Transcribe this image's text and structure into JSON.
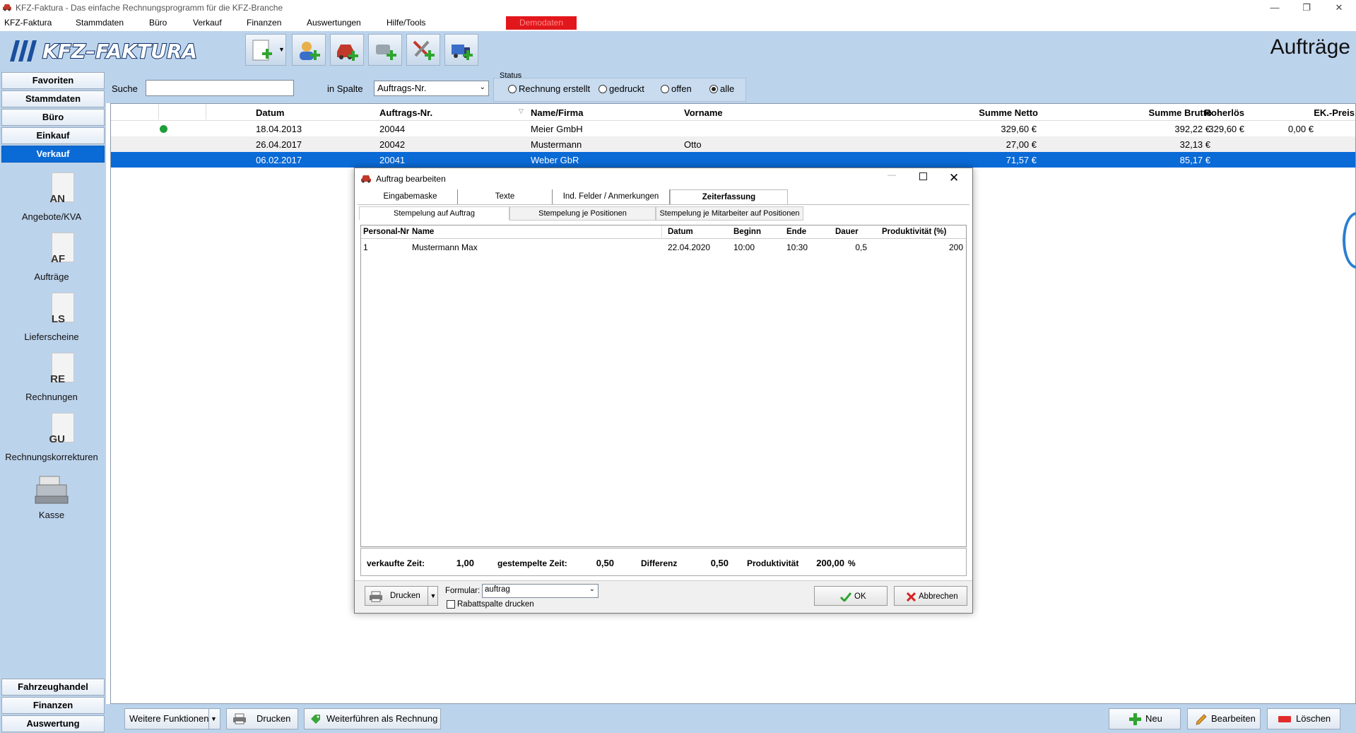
{
  "window": {
    "title": "KFZ-Faktura - Das einfache Rechnungsprogramm für die KFZ-Branche"
  },
  "menu": {
    "items": [
      "KFZ-Faktura",
      "Stammdaten",
      "Büro",
      "Verkauf",
      "Finanzen",
      "Auswertungen",
      "Hilfe/Tools"
    ],
    "demo_badge": "Demodaten"
  },
  "header": {
    "logo_text": "KFZ-FAKTURA",
    "page_title": "Aufträge"
  },
  "sidebar": {
    "sections": [
      "Favoriten",
      "Stammdaten",
      "Büro",
      "Einkauf",
      "Verkauf"
    ],
    "active": "Verkauf",
    "modules": [
      {
        "abbr": "AN",
        "label": "Angebote/KVA"
      },
      {
        "abbr": "AF",
        "label": "Aufträge"
      },
      {
        "abbr": "LS",
        "label": "Lieferscheine"
      },
      {
        "abbr": "RE",
        "label": "Rechnungen"
      },
      {
        "abbr": "GU",
        "label": "Rechnungskorrekturen"
      },
      {
        "abbr": "",
        "label": "Kasse"
      }
    ],
    "bottom_sections": [
      "Fahrzeughandel",
      "Finanzen",
      "Auswertung"
    ]
  },
  "search": {
    "label": "Suche",
    "value": "",
    "column_label": "in Spalte",
    "column_value": "Auftrags-Nr.",
    "status_label": "Status",
    "status_options": [
      "Rechnung erstellt",
      "gedruckt",
      "offen",
      "alle"
    ],
    "status_selected": "alle"
  },
  "grid": {
    "columns": [
      "Datum",
      "Auftrags-Nr.",
      "Name/Firma",
      "Vorname",
      "Summe Netto",
      "Summe Brutto",
      "Roherlös",
      "EK.-Preis"
    ],
    "rows": [
      {
        "datum": "18.04.2013",
        "nr": "20044",
        "name": "Meier GmbH",
        "vorname": "",
        "netto": "329,60 €",
        "brutto": "392,22 €",
        "roherloes": "329,60 €",
        "ek": "0,00 €",
        "status_dot": true
      },
      {
        "datum": "26.04.2017",
        "nr": "20042",
        "name": "Mustermann",
        "vorname": "Otto",
        "netto": "27,00 €",
        "brutto": "32,13 €",
        "roherloes": "",
        "ek": "",
        "status_dot": false
      },
      {
        "datum": "06.02.2017",
        "nr": "20041",
        "name": "Weber GbR",
        "vorname": "",
        "netto": "71,57 €",
        "brutto": "85,17 €",
        "roherloes": "",
        "ek": "",
        "status_dot": false
      }
    ],
    "selected_row": 2
  },
  "bottombar": {
    "more_label": "Weitere Funktionen",
    "print_label": "Drucken",
    "convert_label": "Weiterführen als Rechnung",
    "new_label": "Neu",
    "edit_label": "Bearbeiten",
    "delete_label": "Löschen"
  },
  "dialog": {
    "title": "Auftrag bearbeiten",
    "tabs": [
      "Eingabemaske",
      "Texte",
      "Ind. Felder / Anmerkungen",
      "Zeiterfassung"
    ],
    "active_tab": "Zeiterfassung",
    "subtabs": [
      "Stempelung auf Auftrag",
      "Stempelung je Positionen",
      "Stempelung je Mitarbeiter auf Positionen"
    ],
    "active_subtab": "Stempelung auf Auftrag",
    "table_columns": [
      "Personal-Nr",
      "Name",
      "Datum",
      "Beginn",
      "Ende",
      "Dauer",
      "Produktivität (%)"
    ],
    "table_rows": [
      {
        "pnr": "1",
        "name": "Mustermann Max",
        "datum": "22.04.2020",
        "beginn": "10:00",
        "ende": "10:30",
        "dauer": "0,5",
        "prod": "200"
      }
    ],
    "summary": {
      "sold_label": "verkaufte Zeit:",
      "sold_value": "1,00",
      "stamped_label": "gestempelte Zeit:",
      "stamped_value": "0,50",
      "diff_label": "Differenz",
      "diff_value": "0,50",
      "prod_label": "Produktivität",
      "prod_value": "200,00",
      "prod_unit": "%"
    },
    "footer": {
      "print_label": "Drucken",
      "form_label": "Formular:",
      "form_value": "auftrag",
      "discount_label": "Rabattspalte drucken",
      "ok_label": "OK",
      "cancel_label": "Abbrechen"
    }
  }
}
